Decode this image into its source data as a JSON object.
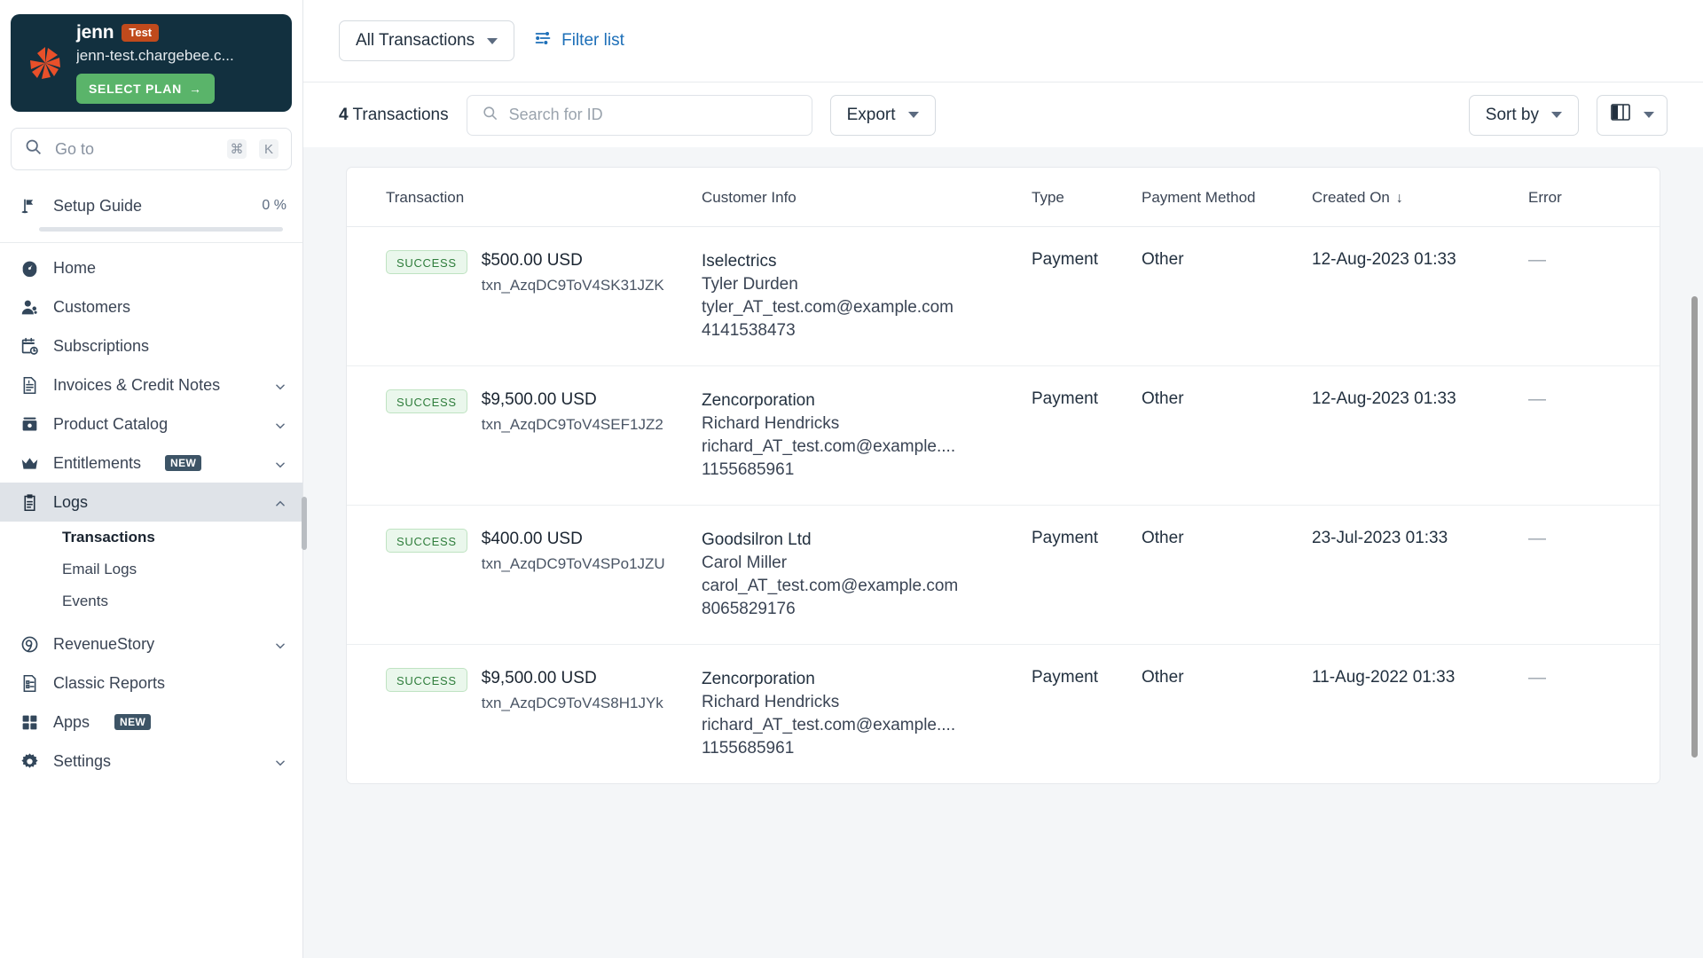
{
  "account": {
    "name": "jenn",
    "badge": "Test",
    "domain": "jenn-test.chargebee.c...",
    "select_plan_label": "SELECT PLAN",
    "select_plan_arrow": "→",
    "logo_icon": "chargebee-logo-icon",
    "badge_color": "#c04a1c",
    "card_bg": "#12303f",
    "button_color": "#5ab46a"
  },
  "goto": {
    "placeholder": "Go to",
    "icon": "search-icon",
    "shortcut_modifier": "⌘",
    "shortcut_key": "K"
  },
  "sidebar": {
    "setup": {
      "label": "Setup Guide",
      "percent": "0 %",
      "icon": "flag-icon",
      "progress_value": 0
    },
    "items": [
      {
        "label": "Home",
        "icon": "gauge-icon",
        "expandable": false,
        "active": false
      },
      {
        "label": "Customers",
        "icon": "users-icon",
        "expandable": false,
        "active": false
      },
      {
        "label": "Subscriptions",
        "icon": "calendar-clock-icon",
        "expandable": false,
        "active": false
      },
      {
        "label": "Invoices & Credit Notes",
        "icon": "invoice-icon",
        "expandable": true,
        "active": false
      },
      {
        "label": "Product Catalog",
        "icon": "box-icon",
        "expandable": true,
        "active": false
      },
      {
        "label": "Entitlements",
        "icon": "crown-icon",
        "expandable": true,
        "active": false,
        "badge": "NEW"
      },
      {
        "label": "Logs",
        "icon": "clipboard-icon",
        "expandable": true,
        "active": true,
        "expanded": true
      },
      {
        "label": "RevenueStory",
        "icon": "target-icon",
        "expandable": true,
        "active": false
      },
      {
        "label": "Classic Reports",
        "icon": "report-icon",
        "expandable": false,
        "active": false
      },
      {
        "label": "Apps",
        "icon": "grid-icon",
        "expandable": false,
        "active": false,
        "badge": "NEW"
      },
      {
        "label": "Settings",
        "icon": "gear-icon",
        "expandable": true,
        "active": false
      }
    ],
    "logs_children": [
      {
        "label": "Transactions",
        "current": true
      },
      {
        "label": "Email Logs",
        "current": false
      },
      {
        "label": "Events",
        "current": false
      }
    ]
  },
  "toolbar": {
    "view_selector_label": "All Transactions",
    "filter_list_label": "Filter list",
    "filter_icon": "filter-sliders-icon",
    "count_number": "4",
    "count_noun": "Transactions",
    "search_placeholder": "Search for ID",
    "search_value": "",
    "search_icon": "search-icon",
    "export_label": "Export",
    "sort_label": "Sort by",
    "columns_icon": "columns-icon"
  },
  "table": {
    "headers": {
      "transaction": "Transaction",
      "customer_info": "Customer Info",
      "type": "Type",
      "payment_method": "Payment Method",
      "created_on": "Created On",
      "error": "Error"
    },
    "sort_indicator": "↓",
    "sorted_column": "Created On",
    "sort_direction": "desc",
    "rows": [
      {
        "status": "SUCCESS",
        "amount": "$500.00 USD",
        "txn_id": "txn_AzqDC9ToV4SK31JZK",
        "company": "Iselectrics",
        "person": "Tyler Durden",
        "email": "tyler_AT_test.com@example.com",
        "phone": "4141538473",
        "type": "Payment",
        "payment_method": "Other",
        "created_on": "12-Aug-2023 01:33",
        "error": "—"
      },
      {
        "status": "SUCCESS",
        "amount": "$9,500.00 USD",
        "txn_id": "txn_AzqDC9ToV4SEF1JZ2",
        "company": "Zencorporation",
        "person": "Richard Hendricks",
        "email": "richard_AT_test.com@example....",
        "phone": "1155685961",
        "type": "Payment",
        "payment_method": "Other",
        "created_on": "12-Aug-2023 01:33",
        "error": "—"
      },
      {
        "status": "SUCCESS",
        "amount": "$400.00 USD",
        "txn_id": "txn_AzqDC9ToV4SPo1JZU",
        "company": "Goodsilron Ltd",
        "person": "Carol Miller",
        "email": "carol_AT_test.com@example.com",
        "phone": "8065829176",
        "type": "Payment",
        "payment_method": "Other",
        "created_on": "23-Jul-2023 01:33",
        "error": "—"
      },
      {
        "status": "SUCCESS",
        "amount": "$9,500.00 USD",
        "txn_id": "txn_AzqDC9ToV4S8H1JYk",
        "company": "Zencorporation",
        "person": "Richard Hendricks",
        "email": "richard_AT_test.com@example....",
        "phone": "1155685961",
        "type": "Payment",
        "payment_method": "Other",
        "created_on": "11-Aug-2022 01:33",
        "error": "—"
      }
    ]
  },
  "colors": {
    "link": "#1d6fb8",
    "success_text": "#2e7d3b",
    "success_bg": "#eaf7ec",
    "page_bg": "#f4f6f8"
  }
}
